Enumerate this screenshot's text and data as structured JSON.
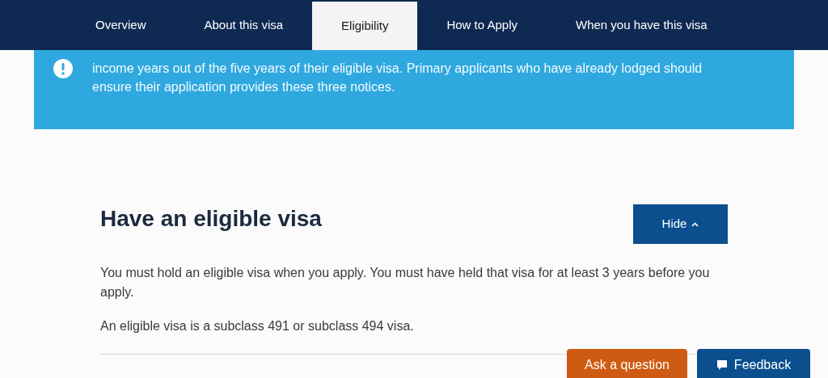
{
  "tabs": [
    {
      "label": "Overview",
      "selected": false
    },
    {
      "label": "About this visa",
      "selected": false
    },
    {
      "label": "Eligibility",
      "selected": true
    },
    {
      "label": "How to Apply",
      "selected": false
    },
    {
      "label": "When you have this visa",
      "selected": false
    }
  ],
  "notice": {
    "lines": [
      "income years out of the five years of their eligible visa. Primary applicants who have already lodged should",
      "ensure their application provides these three notices."
    ]
  },
  "section": {
    "heading": "Have an eligible visa",
    "toggle": "Hide",
    "expanded": true,
    "paragraphs": [
      "You must hold an eligible visa when you apply. You must have held that visa for at least 3 years before you apply.",
      "An eligible visa is a subclass 491 or subclass 494 visa."
    ]
  },
  "floating_buttons": [
    {
      "kind": "ask",
      "label": "Ask a question"
    },
    {
      "kind": "feedback",
      "label": "Feedback"
    }
  ]
}
